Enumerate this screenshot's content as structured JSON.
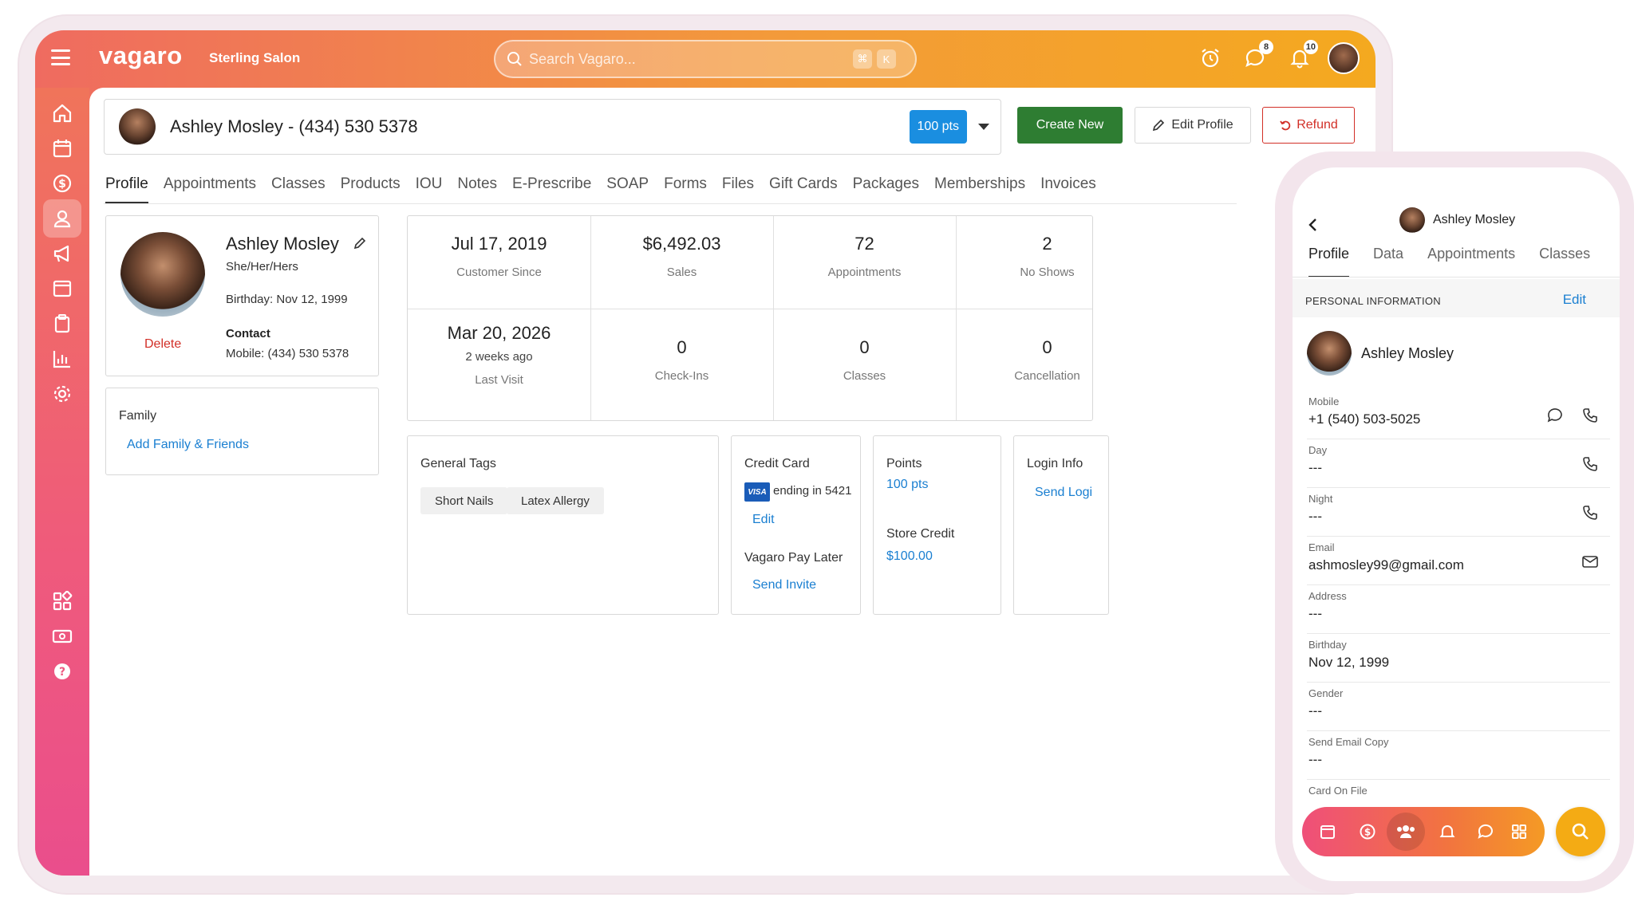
{
  "app": {
    "logo": "vagaro",
    "salon": "Sterling Salon",
    "search_placeholder": "Search Vagaro...",
    "search_kbd": [
      "⌘",
      "K"
    ],
    "badges": {
      "messages": "8",
      "notifications": "10"
    },
    "accent": "#f39a3a"
  },
  "customer": {
    "header": "Ashley Mosley - (434) 530 5378",
    "points_pill": "100 pts",
    "name": "Ashley Mosley",
    "pronouns": "She/Her/Hers",
    "birthday": "Birthday: Nov 12, 1999",
    "contact_label": "Contact",
    "mobile": "Mobile: (434) 530 5378",
    "delete": "Delete"
  },
  "actions": {
    "create": "Create New",
    "edit": "Edit Profile",
    "refund": "Refund"
  },
  "tabs": [
    "Profile",
    "Appointments",
    "Classes",
    "Products",
    "IOU",
    "Notes",
    "E-Prescribe",
    "SOAP",
    "Forms",
    "Files",
    "Gift Cards",
    "Packages",
    "Memberships",
    "Invoices"
  ],
  "family": {
    "title": "Family",
    "link": "Add Family & Friends"
  },
  "stats": {
    "customer_since": {
      "value": "Jul 17, 2019",
      "label": "Customer Since"
    },
    "sales": {
      "value": "$6,492.03",
      "label": "Sales"
    },
    "appointments": {
      "value": "72",
      "label": "Appointments"
    },
    "no_shows": {
      "value": "2",
      "label": "No Shows"
    },
    "last_visit": {
      "value": "Mar 20, 2026",
      "sub": "2 weeks ago",
      "label": "Last Visit"
    },
    "check_ins": {
      "value": "0",
      "label": "Check-Ins"
    },
    "classes": {
      "value": "0",
      "label": "Classes"
    },
    "cancellations": {
      "value": "0",
      "label": "Cancellation"
    }
  },
  "general_tags": {
    "title": "General Tags",
    "tags": [
      "Short Nails",
      "Latex Allergy"
    ]
  },
  "credit_card": {
    "title": "Credit Card",
    "brand": "VISA",
    "ending": "ending in 5421",
    "edit": "Edit",
    "pay_later": "Vagaro Pay Later",
    "send_invite": "Send Invite"
  },
  "points": {
    "title": "Points",
    "value": "100 pts",
    "store_credit_label": "Store Credit",
    "store_credit": "$100.00"
  },
  "login_info": {
    "title": "Login Info",
    "link": "Send Logi"
  },
  "phone": {
    "name": "Ashley Mosley",
    "tabs": [
      "Profile",
      "Data",
      "Appointments",
      "Classes"
    ],
    "section_title": "PERSONAL INFORMATION",
    "edit": "Edit",
    "fields": [
      {
        "label": "Mobile",
        "value": "+1 (540) 503-5025"
      },
      {
        "label": "Day",
        "value": "---"
      },
      {
        "label": "Night",
        "value": "---"
      },
      {
        "label": "Email",
        "value": "ashmosley99@gmail.com"
      },
      {
        "label": "Address",
        "value": "---"
      },
      {
        "label": "Birthday",
        "value": "Nov 12, 1999"
      },
      {
        "label": "Gender",
        "value": "---"
      },
      {
        "label": "Send Email Copy",
        "value": "---"
      },
      {
        "label": "Card On File",
        "value": ""
      }
    ]
  }
}
